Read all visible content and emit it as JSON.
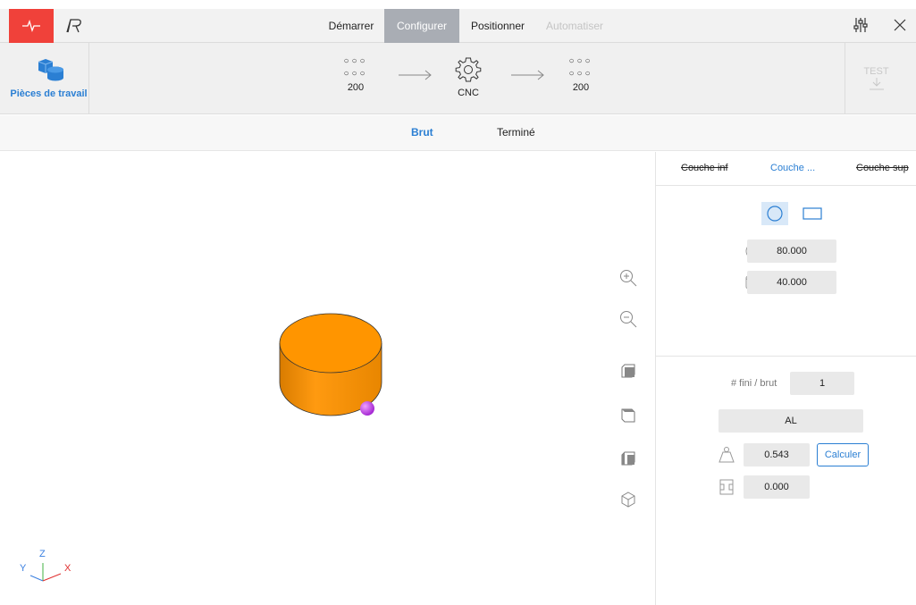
{
  "nav": {
    "tabs": [
      {
        "label": "Démarrer",
        "state": "normal"
      },
      {
        "label": "Configurer",
        "state": "active"
      },
      {
        "label": "Positionner",
        "state": "normal"
      },
      {
        "label": "Automatiser",
        "state": "disabled"
      }
    ],
    "brand_color": "#f0413a",
    "accent_color": "#2b7fd3",
    "icons": [
      "pulse-icon",
      "robot-logo-icon",
      "sliders-icon",
      "close-icon"
    ]
  },
  "pipeline": {
    "workpieces_label": "Pièces de travail",
    "stages": [
      {
        "top_dots": "○○○",
        "bottom_dots": "○○○",
        "value": "200"
      },
      {
        "icon": "gear-icon",
        "value": "CNC"
      },
      {
        "top_dots": "○○○",
        "bottom_dots": "○○○",
        "value": "200"
      }
    ],
    "test_label": "TEST"
  },
  "subtabs": [
    {
      "label": "Brut",
      "active": true
    },
    {
      "label": "Terminé",
      "active": false
    }
  ],
  "viewport": {
    "axes": {
      "z": "Z",
      "y": "Y",
      "x": "X"
    },
    "tools": [
      "zoom-in-icon",
      "zoom-out-icon",
      "view-front-icon",
      "view-top-icon",
      "view-side-icon",
      "view-iso-icon"
    ],
    "part_color": "#ff9500",
    "marker_color": "#c040e8"
  },
  "panel": {
    "layers": [
      {
        "label": "Couche inf",
        "state": "strike"
      },
      {
        "label": "Couche ...",
        "state": "active"
      },
      {
        "label": "Couche sup",
        "state": "strike"
      }
    ],
    "shape_selected": "circle",
    "diameter": "80.000",
    "height": "40.000",
    "count_label": "# fini / brut",
    "count_value": "1",
    "material": "AL",
    "weight": "0.543",
    "calc_label": "Calculer",
    "offset": "0.000"
  }
}
